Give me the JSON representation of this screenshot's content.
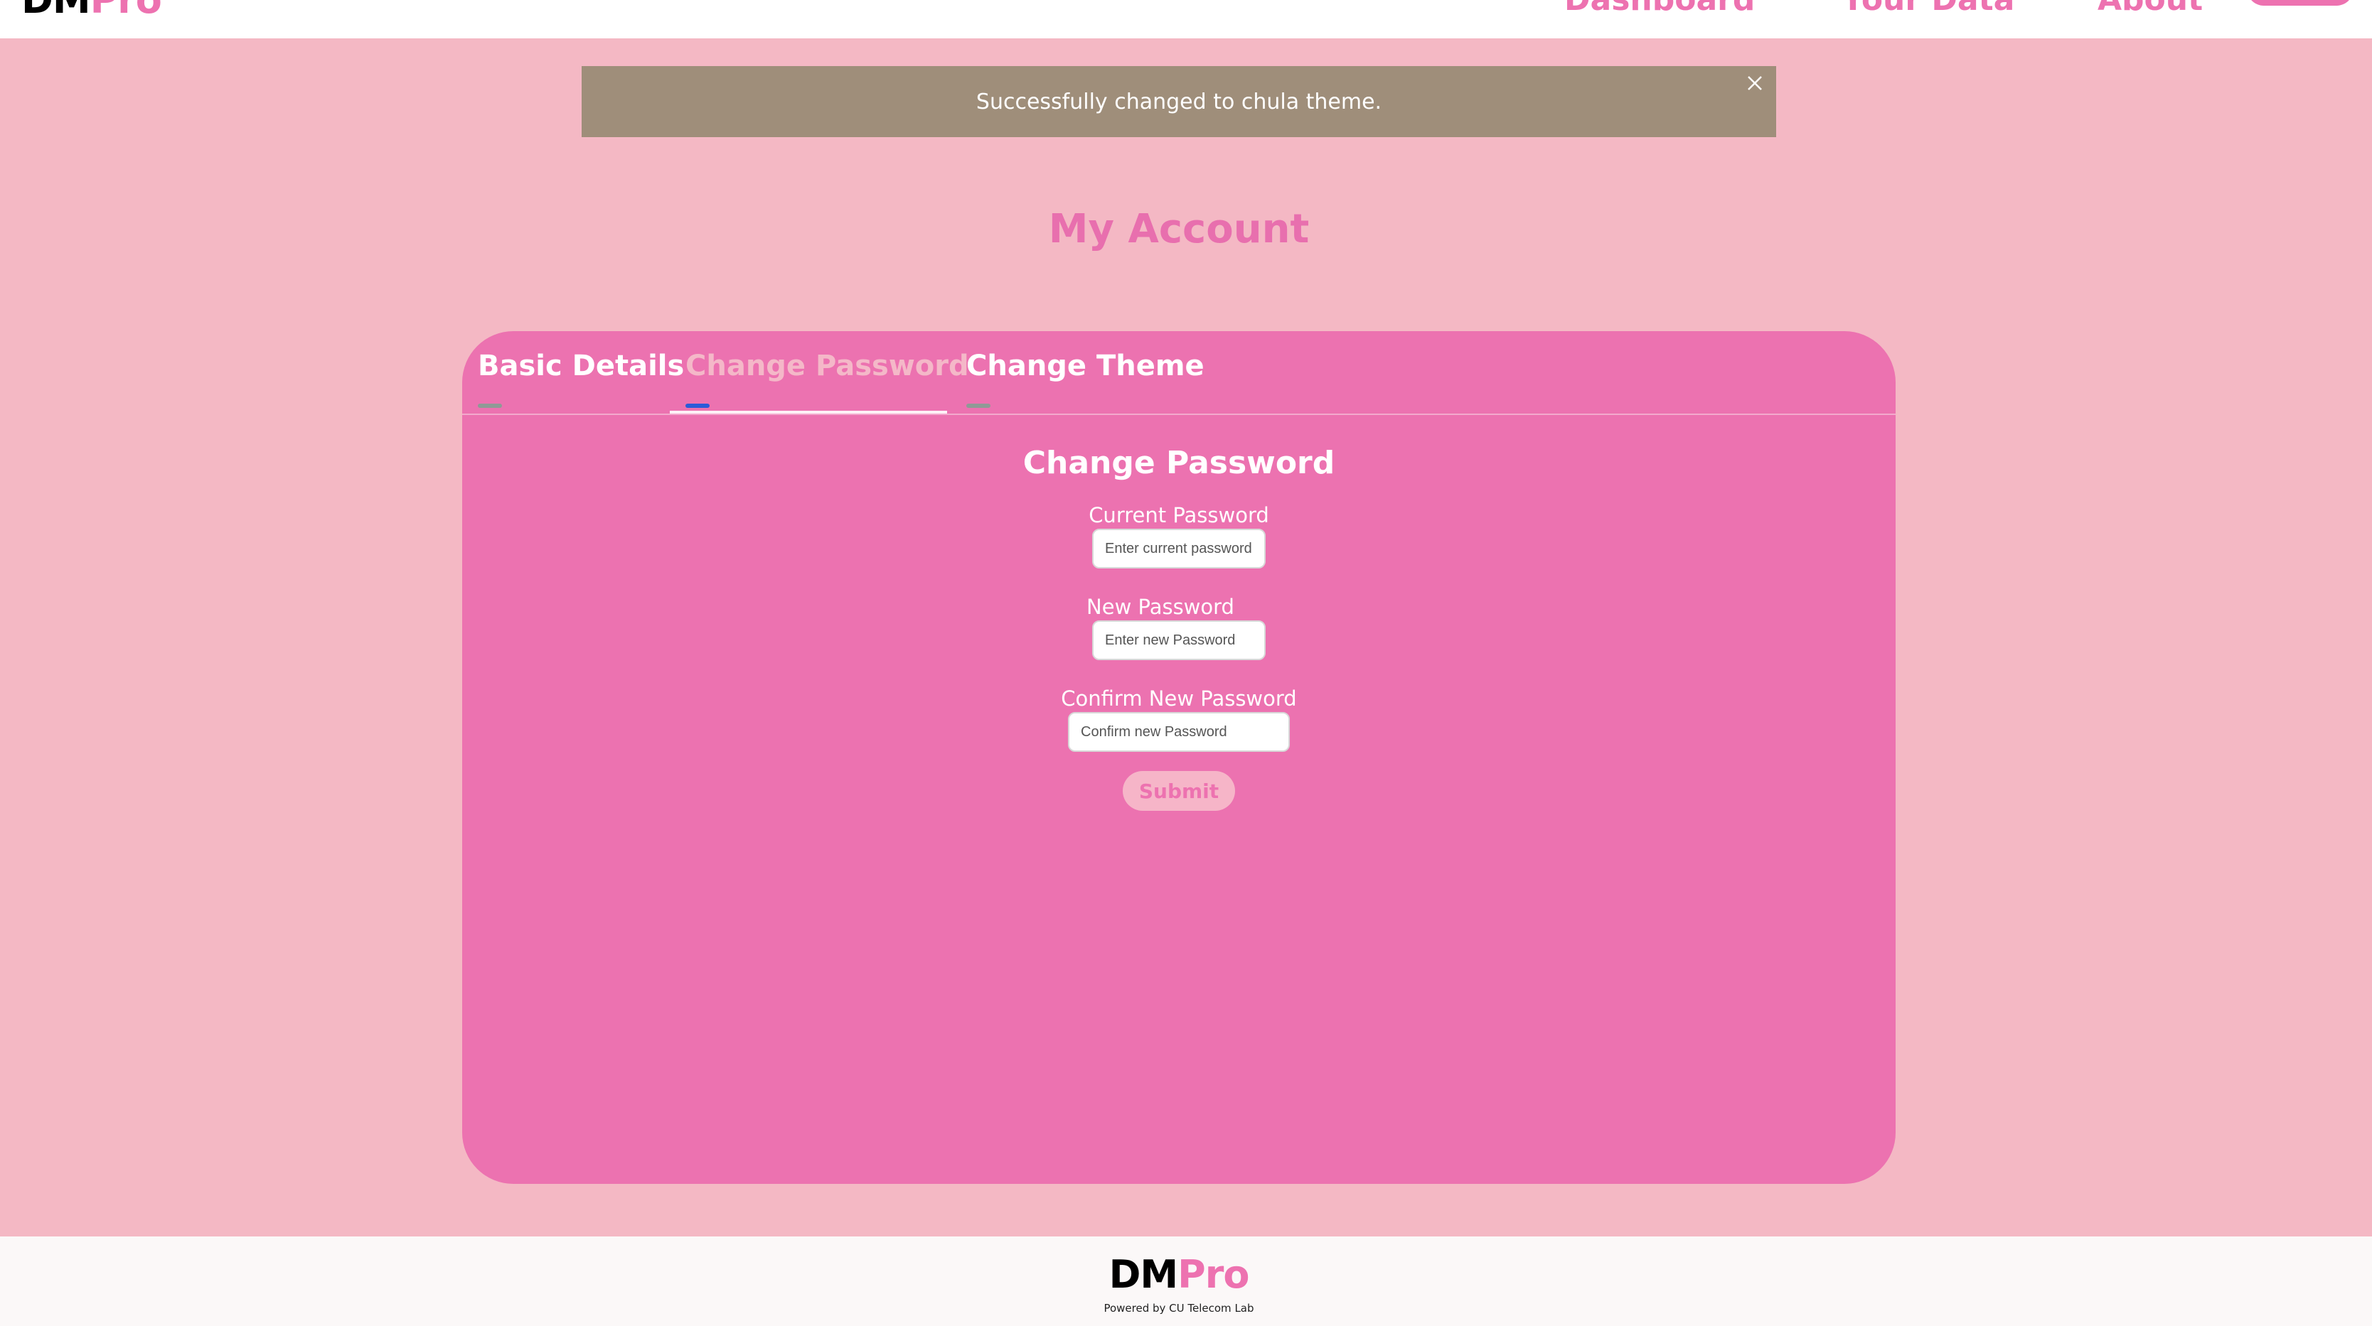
{
  "header": {
    "logo_dm": "DM",
    "logo_pro": "Pro",
    "nav": {
      "dashboard": "Dashboard",
      "your_data": "Your Data",
      "about": "About"
    }
  },
  "toast": {
    "message": "Successfully changed to chula theme.",
    "close_icon": "close-icon"
  },
  "page": {
    "title": "My Account"
  },
  "tabs": {
    "basic_details": "Basic Details",
    "change_password": "Change Password",
    "change_theme": "Change Theme",
    "active": "change_password"
  },
  "form": {
    "title": "Change Password",
    "current_label": "Current Password",
    "current_placeholder": "Enter current password",
    "new_label": "New Password",
    "new_placeholder": "Enter new Password",
    "confirm_label": "Confirm New Password",
    "confirm_placeholder": "Confirm new Password",
    "submit_label": "Submit"
  },
  "footer": {
    "logo_dm": "DM",
    "logo_pro": "Pro",
    "powered_by": "Powered by CU Telecom Lab"
  },
  "colors": {
    "background": "#f4b8c4",
    "card": "#ec72b0",
    "accent": "#ed72b0",
    "toast": "#9f8e7a",
    "active_tab_indicator": "#2b5bd8"
  }
}
